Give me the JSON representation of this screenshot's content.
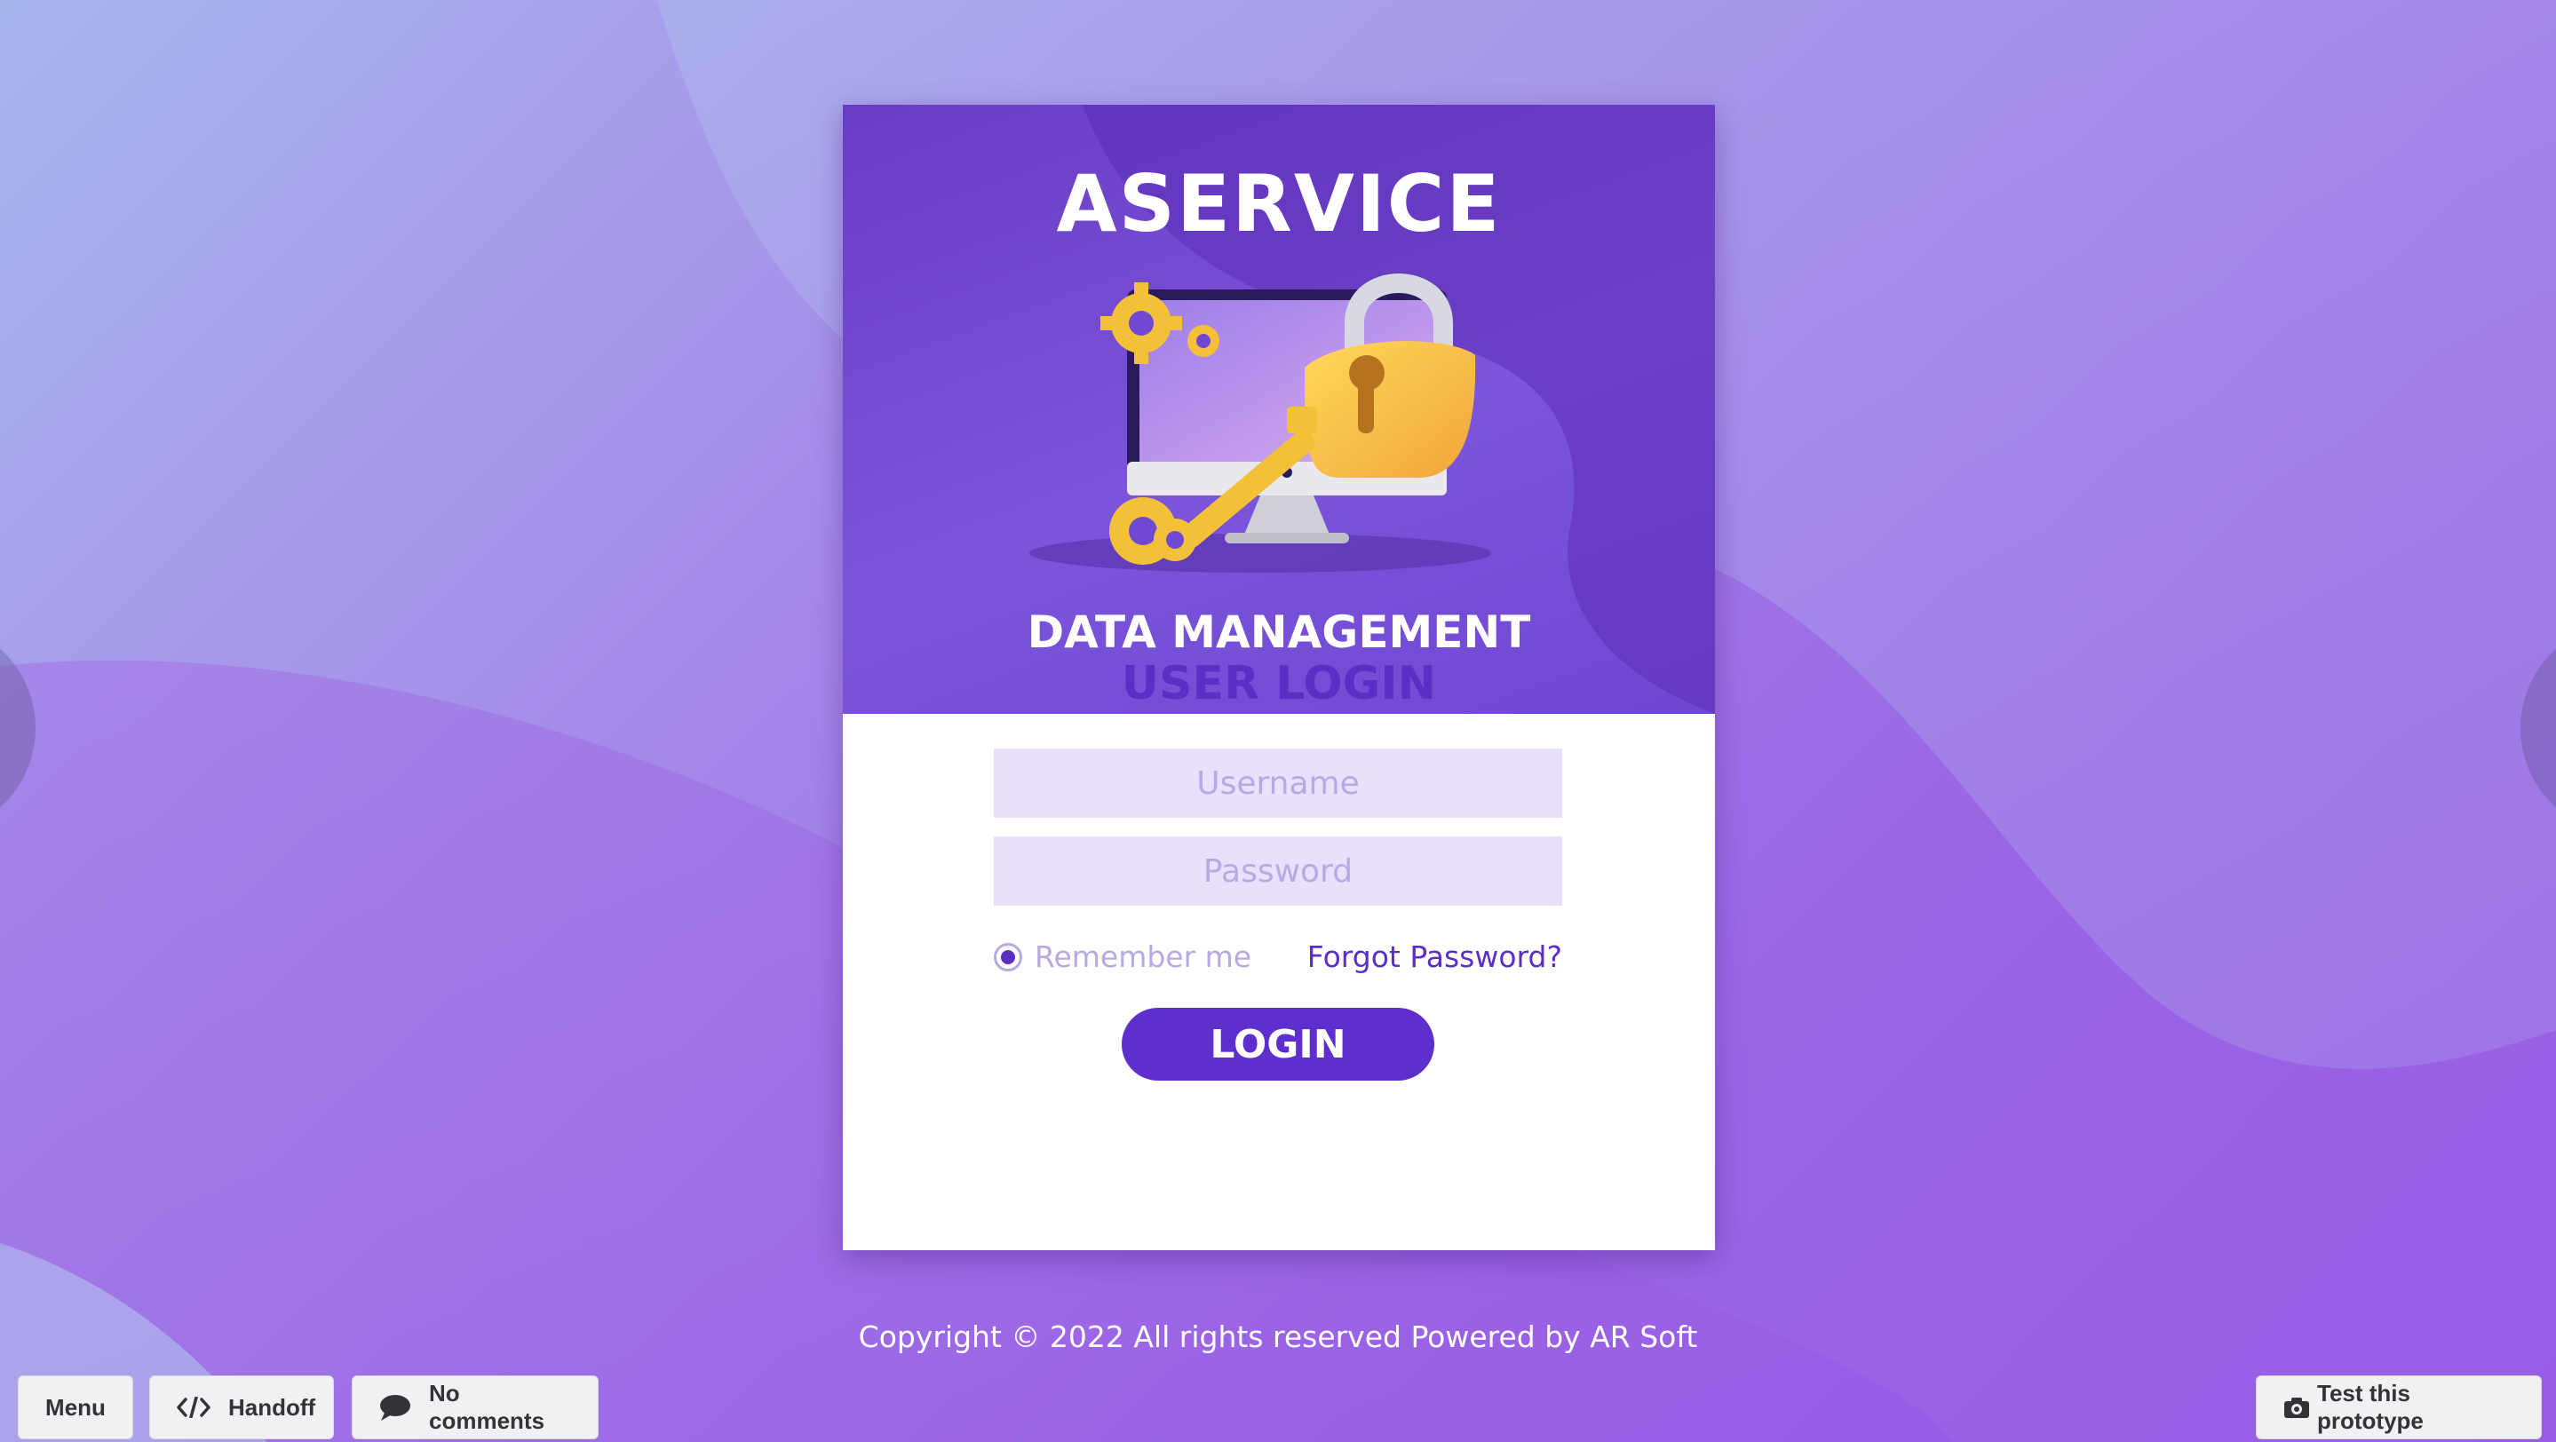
{
  "brand": {
    "name": "ASERVICE",
    "tagline": "DATA MANAGEMENT"
  },
  "login": {
    "title": "USER LOGIN",
    "username_placeholder": "Username",
    "password_placeholder": "Password",
    "remember_label": "Remember me",
    "remember_checked": true,
    "forgot_label": "Forgot Password?",
    "submit_label": "LOGIN"
  },
  "footer": {
    "copyright": "Copyright © 2022 All rights reserved Powered by AR Soft"
  },
  "toolbar": {
    "menu_label": "Menu",
    "handoff_label": "Handoff",
    "comments_label": "No comments",
    "test_label": "Test this prototype"
  },
  "icons": {
    "handoff": "code-icon",
    "comments": "speech-bubble-icon",
    "test": "camera-icon",
    "illustration": [
      "gear-icon",
      "computer-monitor-icon",
      "padlock-icon",
      "key-icon"
    ]
  },
  "colors": {
    "accent": "#5e2fcc",
    "header_bg": "#7048d4",
    "field_bg": "#e9e1fb",
    "placeholder": "#b9a9e3",
    "key_gold": "#f3c138"
  }
}
